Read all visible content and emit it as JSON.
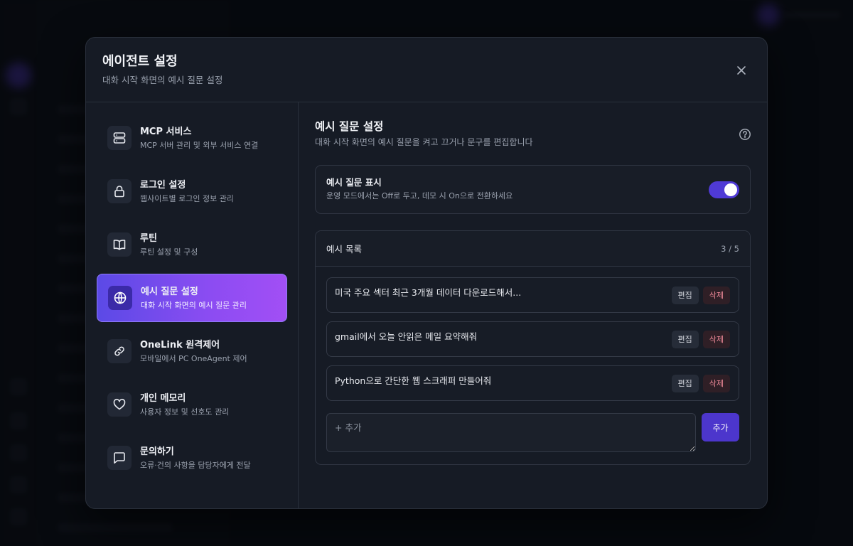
{
  "modal": {
    "title": "에이전트 설정",
    "subtitle": "대화 시작 화면의 예시 질문 설정"
  },
  "sidebar": {
    "items": [
      {
        "title": "MCP 서비스",
        "desc": "MCP 서버 관리 및 외부 서비스 연결",
        "icon": "server-icon"
      },
      {
        "title": "로그인 설정",
        "desc": "웹사이트별 로그인 정보 관리",
        "icon": "lock-icon"
      },
      {
        "title": "루틴",
        "desc": "루틴 설정 및 구성",
        "icon": "book-icon"
      },
      {
        "title": "예시 질문 설정",
        "desc": "대화 시작 화면의 예시 질문 관리",
        "icon": "globe-icon",
        "active": true
      },
      {
        "title": "OneLink 원격제어",
        "desc": "모바일에서 PC OneAgent 제어",
        "icon": "link-icon"
      },
      {
        "title": "개인 메모리",
        "desc": "사용자 정보 및 선호도 관리",
        "icon": "heart-icon"
      },
      {
        "title": "문의하기",
        "desc": "오류·건의 사항을 담당자에게 전달",
        "icon": "message-icon"
      }
    ]
  },
  "content": {
    "title": "예시 질문 설정",
    "desc": "대화 시작 화면의 예시 질문을 켜고 끄거나 문구를 편집합니다",
    "toggle_card": {
      "title": "예시 질문 표시",
      "desc": "운영 모드에서는 Off로 두고, 데모 시 On으로 전환하세요",
      "enabled": true
    },
    "list": {
      "title": "예시 목록",
      "count": "3 / 5",
      "items": [
        {
          "text": "미국 주요 섹터 최근 3개월 데이터 다운로드해서..."
        },
        {
          "text": "gmail에서 오늘 안읽은 메일 요약해줘"
        },
        {
          "text": "Python으로 간단한 웹 스크래퍼 만들어줘"
        }
      ],
      "edit_label": "편집",
      "delete_label": "삭제",
      "add_placeholder": "+ 추가",
      "add_label": "추가"
    }
  },
  "colors": {
    "accent": "#4f3ad6",
    "active_gradient_start": "#5b4ae6",
    "active_gradient_end": "#a24ff5",
    "danger_text": "#f08a9a"
  }
}
